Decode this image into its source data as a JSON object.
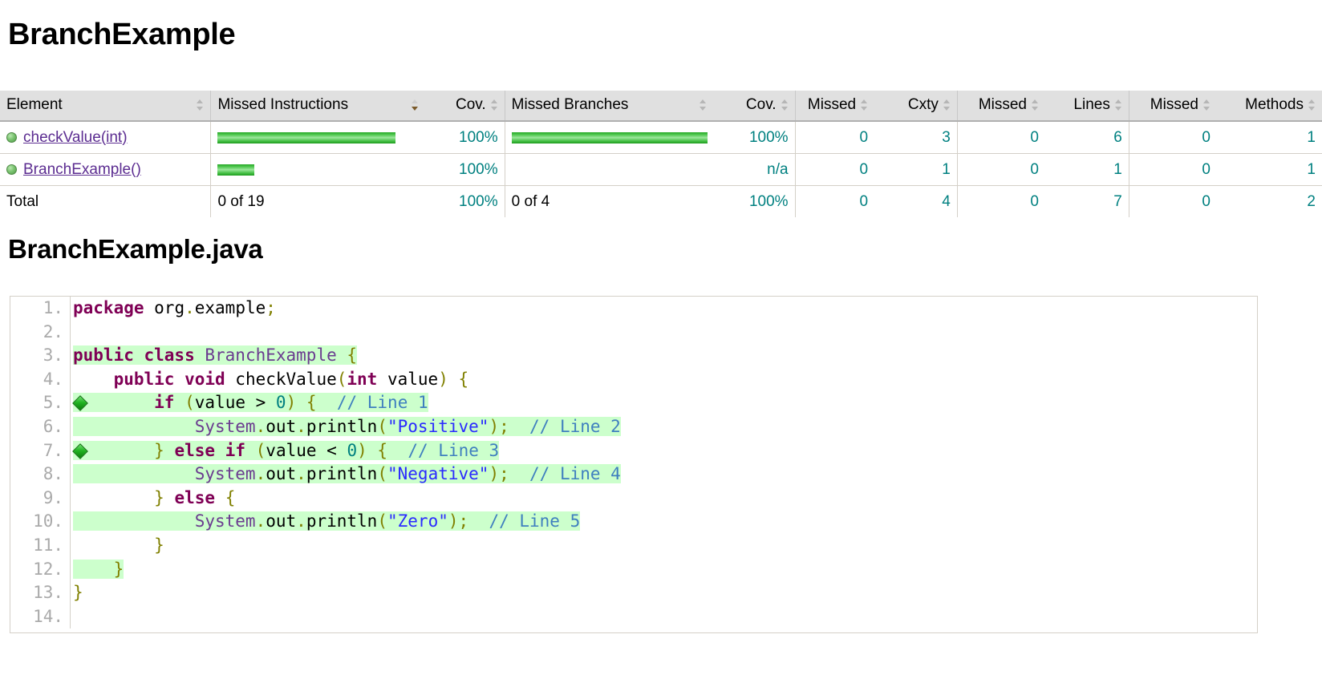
{
  "page_title": "BranchExample",
  "file_title": "BranchExample.java",
  "table": {
    "columns": [
      {
        "label": "Element",
        "align": "left",
        "sorted": false
      },
      {
        "label": "Missed Instructions",
        "align": "left",
        "sorted": true
      },
      {
        "label": "Cov.",
        "align": "right",
        "sorted": false
      },
      {
        "label": "Missed Branches",
        "align": "left",
        "sorted": false
      },
      {
        "label": "Cov.",
        "align": "right",
        "sorted": false
      },
      {
        "label": "Missed",
        "align": "right",
        "sorted": false
      },
      {
        "label": "Cxty",
        "align": "right",
        "sorted": false
      },
      {
        "label": "Missed",
        "align": "right",
        "sorted": false
      },
      {
        "label": "Lines",
        "align": "right",
        "sorted": false
      },
      {
        "label": "Missed",
        "align": "right",
        "sorted": false
      },
      {
        "label": "Methods",
        "align": "right",
        "sorted": false
      }
    ],
    "rows": [
      {
        "element": "checkValue(int)",
        "is_link": true,
        "icon": "method-green-icon",
        "instr_bar_pct": 100,
        "instr_bar_width": 222,
        "instr_cov": "100%",
        "branch_bar_pct": 100,
        "branch_bar_width": 244,
        "branch_cov": "100%",
        "missed_cxty": "0",
        "cxty": "3",
        "missed_lines": "0",
        "lines": "6",
        "missed_methods": "0",
        "methods": "1"
      },
      {
        "element": "BranchExample()",
        "is_link": true,
        "icon": "method-green-icon",
        "instr_bar_pct": 100,
        "instr_bar_width": 46,
        "instr_cov": "100%",
        "branch_bar_pct": 0,
        "branch_bar_width": 0,
        "branch_cov": "n/a",
        "missed_cxty": "0",
        "cxty": "1",
        "missed_lines": "0",
        "lines": "1",
        "missed_methods": "0",
        "methods": "1"
      }
    ],
    "total": {
      "element": "Total",
      "instructions": "0 of 19",
      "instr_cov": "100%",
      "branches": "0 of 4",
      "branch_cov": "100%",
      "missed_cxty": "0",
      "cxty": "4",
      "missed_lines": "0",
      "lines": "7",
      "missed_methods": "0",
      "methods": "2"
    }
  },
  "source": {
    "line_numbers": [
      "1.",
      "2.",
      "3.",
      "4.",
      "5.",
      "6.",
      "7.",
      "8.",
      "9.",
      "10.",
      "11.",
      "12.",
      "13.",
      "14."
    ],
    "lines": [
      {
        "n": 1,
        "text": "package org.example;",
        "covered": false,
        "marker": null
      },
      {
        "n": 2,
        "text": "",
        "covered": false,
        "marker": null
      },
      {
        "n": 3,
        "text": "public class BranchExample {",
        "covered": true,
        "marker": null
      },
      {
        "n": 4,
        "text": "    public void checkValue(int value) {",
        "covered": false,
        "marker": null
      },
      {
        "n": 5,
        "text": "        if (value > 0) {  // Line 1",
        "covered": true,
        "marker": "branch-full-icon"
      },
      {
        "n": 6,
        "text": "            System.out.println(\"Positive\");  // Line 2",
        "covered": true,
        "marker": null
      },
      {
        "n": 7,
        "text": "        } else if (value < 0) {  // Line 3",
        "covered": true,
        "marker": "branch-full-icon"
      },
      {
        "n": 8,
        "text": "            System.out.println(\"Negative\");  // Line 4",
        "covered": true,
        "marker": null
      },
      {
        "n": 9,
        "text": "        } else {",
        "covered": false,
        "marker": null
      },
      {
        "n": 10,
        "text": "            System.out.println(\"Zero\");  // Line 5",
        "covered": true,
        "marker": null
      },
      {
        "n": 11,
        "text": "        }",
        "covered": false,
        "marker": null
      },
      {
        "n": 12,
        "text": "    }",
        "covered": true,
        "marker": null
      },
      {
        "n": 13,
        "text": "}",
        "covered": false,
        "marker": null
      },
      {
        "n": 14,
        "text": "",
        "covered": false,
        "marker": null
      }
    ]
  },
  "colors": {
    "covered_line_bg": "#ccffcc",
    "bar_green": "#22b322",
    "link_purple": "#5c2d91",
    "header_bg": "#e0e0e0",
    "keyword": "#7f0055",
    "string": "#2a2aff",
    "comment": "#3f7fbf",
    "number": "#008080",
    "brace": "#808000",
    "type": "#6a3b8f"
  }
}
